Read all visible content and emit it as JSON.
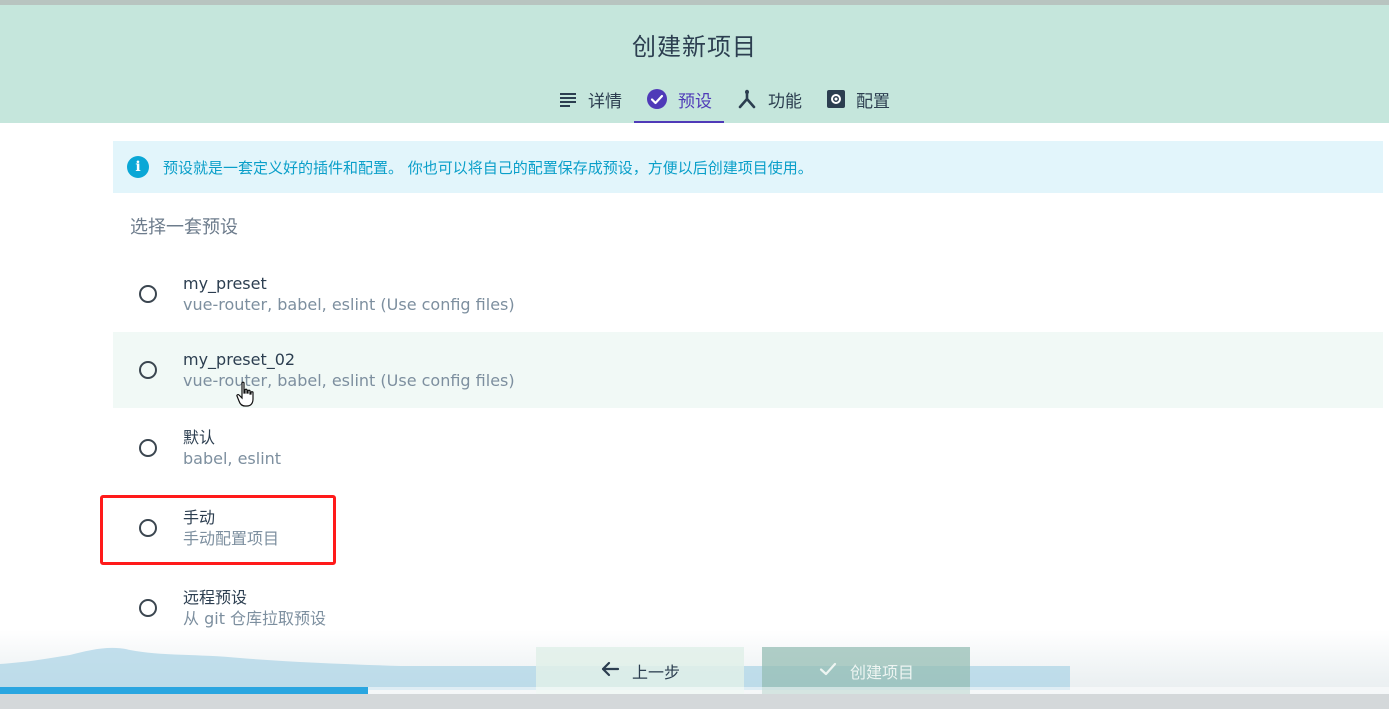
{
  "header": {
    "title": "创建新项目",
    "tabs": [
      {
        "label": "详情",
        "icon": "list-icon",
        "active": false
      },
      {
        "label": "预设",
        "icon": "check-circle-icon",
        "active": true
      },
      {
        "label": "功能",
        "icon": "fork-icon",
        "active": false
      },
      {
        "label": "配置",
        "icon": "settings-icon",
        "active": false
      }
    ]
  },
  "info": {
    "icon": "info-icon",
    "text": "预设就是一套定义好的插件和配置。 你也可以将自己的配置保存成预设，方便以后创建项目使用。"
  },
  "section_title": "选择一套预设",
  "presets": [
    {
      "name": "my_preset",
      "description": "vue-router, babel, eslint (Use config files)"
    },
    {
      "name": "my_preset_02",
      "description": "vue-router, babel, eslint (Use config files)"
    },
    {
      "name": "默认",
      "description": "babel, eslint"
    },
    {
      "name": "手动",
      "description": "手动配置项目"
    },
    {
      "name": "远程预设",
      "description": "从 git 仓库拉取预设"
    }
  ],
  "buttons": {
    "back": "上一步",
    "create": "创建项目"
  },
  "video_progress": 0.265,
  "colors": {
    "accent": "#4f3ab8",
    "header_bg": "#c5e6dc",
    "info_text": "#0a9fc9",
    "highlight": "#ff1a1a"
  }
}
